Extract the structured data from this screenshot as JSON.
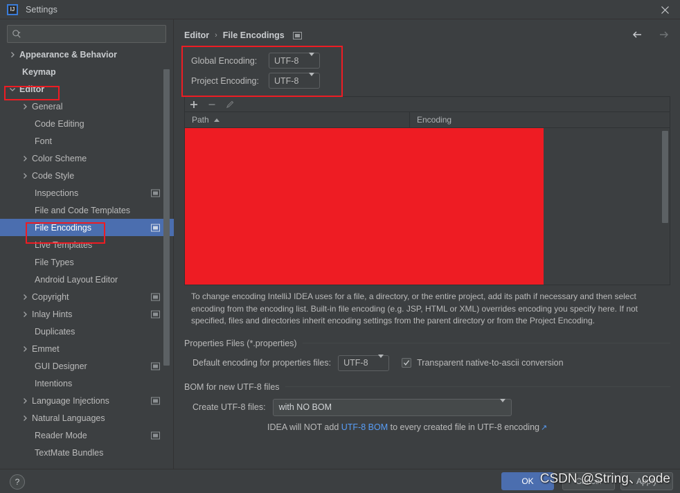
{
  "window": {
    "title": "Settings",
    "logo_text": "IJ",
    "close_label": "✕"
  },
  "search": {
    "value": "",
    "placeholder": ""
  },
  "sidebar": {
    "items": [
      {
        "label": "Appearance & Behavior",
        "level": 0,
        "arrow": "right",
        "selected": false,
        "monitor": false
      },
      {
        "label": "Keymap",
        "level": 0,
        "arrow": "none",
        "selected": false,
        "monitor": false
      },
      {
        "label": "Editor",
        "level": 0,
        "arrow": "down",
        "selected": false,
        "monitor": false
      },
      {
        "label": "General",
        "level": 1,
        "arrow": "right",
        "selected": false,
        "monitor": false
      },
      {
        "label": "Code Editing",
        "level": 1,
        "arrow": "none",
        "selected": false,
        "monitor": false
      },
      {
        "label": "Font",
        "level": 1,
        "arrow": "none",
        "selected": false,
        "monitor": false
      },
      {
        "label": "Color Scheme",
        "level": 1,
        "arrow": "right",
        "selected": false,
        "monitor": false
      },
      {
        "label": "Code Style",
        "level": 1,
        "arrow": "right",
        "selected": false,
        "monitor": false
      },
      {
        "label": "Inspections",
        "level": 1,
        "arrow": "none",
        "selected": false,
        "monitor": true
      },
      {
        "label": "File and Code Templates",
        "level": 1,
        "arrow": "none",
        "selected": false,
        "monitor": false
      },
      {
        "label": "File Encodings",
        "level": 1,
        "arrow": "none",
        "selected": true,
        "monitor": true
      },
      {
        "label": "Live Templates",
        "level": 1,
        "arrow": "none",
        "selected": false,
        "monitor": false
      },
      {
        "label": "File Types",
        "level": 1,
        "arrow": "none",
        "selected": false,
        "monitor": false
      },
      {
        "label": "Android Layout Editor",
        "level": 1,
        "arrow": "none",
        "selected": false,
        "monitor": false
      },
      {
        "label": "Copyright",
        "level": 1,
        "arrow": "right",
        "selected": false,
        "monitor": true
      },
      {
        "label": "Inlay Hints",
        "level": 1,
        "arrow": "right",
        "selected": false,
        "monitor": true
      },
      {
        "label": "Duplicates",
        "level": 1,
        "arrow": "none",
        "selected": false,
        "monitor": false
      },
      {
        "label": "Emmet",
        "level": 1,
        "arrow": "right",
        "selected": false,
        "monitor": false
      },
      {
        "label": "GUI Designer",
        "level": 1,
        "arrow": "none",
        "selected": false,
        "monitor": true
      },
      {
        "label": "Intentions",
        "level": 1,
        "arrow": "none",
        "selected": false,
        "monitor": false
      },
      {
        "label": "Language Injections",
        "level": 1,
        "arrow": "right",
        "selected": false,
        "monitor": true
      },
      {
        "label": "Natural Languages",
        "level": 1,
        "arrow": "right",
        "selected": false,
        "monitor": false
      },
      {
        "label": "Reader Mode",
        "level": 1,
        "arrow": "none",
        "selected": false,
        "monitor": true
      },
      {
        "label": "TextMate Bundles",
        "level": 1,
        "arrow": "none",
        "selected": false,
        "monitor": false
      }
    ]
  },
  "breadcrumb": {
    "parent": "Editor",
    "separator": "›",
    "current": "File Encodings"
  },
  "encoding": {
    "global_label": "Global Encoding:",
    "global_value": "UTF-8",
    "project_label": "Project Encoding:",
    "project_value": "UTF-8"
  },
  "table": {
    "add_title": "Add",
    "remove_title": "Remove",
    "edit_title": "Edit",
    "col_path": "Path",
    "col_encoding": "Encoding",
    "rows": []
  },
  "description": "To change encoding IntelliJ IDEA uses for a file, a directory, or the entire project, add its path if necessary and then select encoding from the encoding list. Built-in file encoding (e.g. JSP, HTML or XML) overrides encoding you specify here. If not specified, files and directories inherit encoding settings from the parent directory or from the Project Encoding.",
  "properties_section": {
    "title": "Properties Files (*.properties)",
    "default_encoding_label": "Default encoding for properties files:",
    "default_encoding_value": "UTF-8",
    "transparent_checkbox_label": "Transparent native-to-ascii conversion",
    "transparent_checked": true
  },
  "bom_section": {
    "title": "BOM for new UTF-8 files",
    "create_label": "Create UTF-8 files:",
    "create_value": "with NO BOM",
    "note_prefix": "IDEA will NOT add ",
    "note_link": "UTF-8 BOM",
    "note_suffix": " to every created file in UTF-8 encoding",
    "external_link_glyph": "↗"
  },
  "footer": {
    "help_glyph": "?",
    "ok": "OK",
    "cancel": "Cancel",
    "apply": "Apply"
  },
  "watermark": {
    "text": "CSDN @String、code"
  },
  "colors": {
    "background": "#3c3f41",
    "selection": "#4b6eaf",
    "accent_link": "#589df6",
    "annotation_red": "#ee1c23",
    "redaction_red": "#ee1c23",
    "text": "#bbbbbb"
  }
}
